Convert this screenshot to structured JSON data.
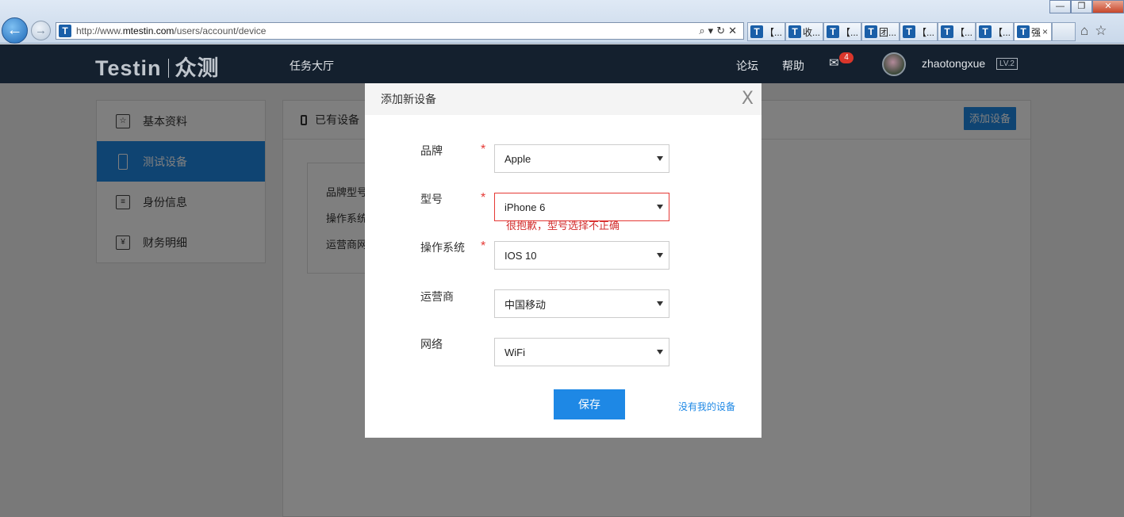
{
  "browser": {
    "url_prefix": "http://www.",
    "url_domain": "mtestin.com",
    "url_path": "/users/account/device",
    "tabs": [
      {
        "label": "【..."
      },
      {
        "label": "收..."
      },
      {
        "label": "【..."
      },
      {
        "label": "团..."
      },
      {
        "label": "【..."
      },
      {
        "label": "【..."
      },
      {
        "label": "【..."
      },
      {
        "label": "强"
      }
    ],
    "active_tab_close": "×",
    "window_buttons": {
      "minimize": "—",
      "restore": "❐",
      "close": "✕"
    }
  },
  "header": {
    "logo_left": "Testin",
    "logo_right": "众测",
    "nav_task": "任务大厅",
    "nav_forum": "论坛",
    "nav_help": "帮助",
    "mail_count": "4",
    "username": "zhaotongxue",
    "level": "LV.2"
  },
  "sidebar": {
    "items": [
      {
        "label": "基本资料",
        "icon": "star-card-icon"
      },
      {
        "label": "测试设备",
        "icon": "phone-icon"
      },
      {
        "label": "身份信息",
        "icon": "id-card-icon"
      },
      {
        "label": "财务明细",
        "icon": "yen-icon"
      }
    ]
  },
  "panel": {
    "title": "已有设备",
    "add_button": "添加设备",
    "card_rows": [
      "品牌型号",
      "操作系统",
      "运营商网"
    ]
  },
  "modal": {
    "title": "添加新设备",
    "close": "X",
    "fields": [
      {
        "label": "品牌",
        "required": "*",
        "value": "Apple"
      },
      {
        "label": "型号",
        "required": "*",
        "value": "iPhone 6"
      },
      {
        "label": "操作系统",
        "required": "*",
        "value": "IOS 10"
      },
      {
        "label": "运营商",
        "value": "中国移动"
      },
      {
        "label": "网络",
        "value": "WiFi"
      }
    ],
    "model_error": "很抱歉，型号选择不正确",
    "save_button": "保存",
    "no_device_link": "没有我的设备"
  },
  "colors": {
    "accent": "#1e88e5",
    "error": "#e53935",
    "header_bg": "#14202e",
    "mail_badge": "#d9362b"
  }
}
